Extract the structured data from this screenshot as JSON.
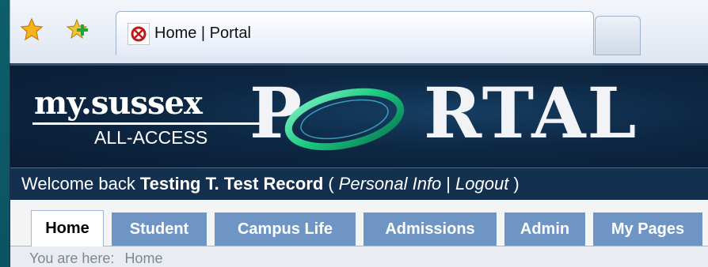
{
  "browser": {
    "tab_title": "Home | Portal",
    "icons": [
      "star-bookmark-icon",
      "add-bookmark-icon",
      "site-favicon"
    ]
  },
  "banner": {
    "logo_main": "my.sussex",
    "logo_sub": "ALL-ACCESS",
    "logo_portal": "PRTAL"
  },
  "welcome": {
    "prefix": "Welcome back",
    "user_name": "Testing T. Test Record",
    "open_paren": "(",
    "personal_info_link": "Personal Info",
    "separator": "|",
    "logout_link": "Logout",
    "close_paren": ")"
  },
  "nav": {
    "tabs": [
      {
        "label": "Home",
        "active": true
      },
      {
        "label": "Student",
        "active": false
      },
      {
        "label": "Campus Life",
        "active": false
      },
      {
        "label": "Admissions",
        "active": false
      },
      {
        "label": "Admin",
        "active": false
      },
      {
        "label": "My Pages",
        "active": false
      }
    ]
  },
  "breadcrumb": {
    "label": "You are here:",
    "current": "Home"
  },
  "colors": {
    "banner": "#0d2743",
    "welcome_bar": "#13304f",
    "nav_tab": "#6e95c4",
    "ring": "#22d08a"
  }
}
